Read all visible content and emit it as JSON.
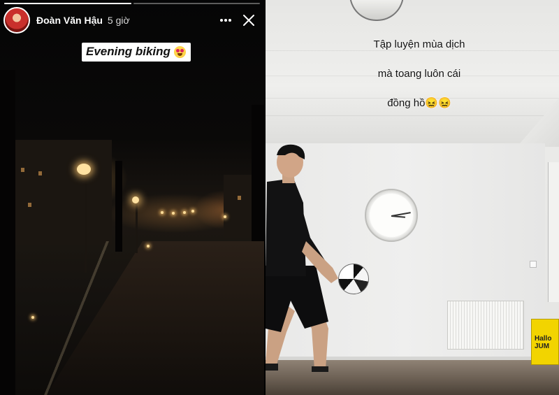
{
  "left_story": {
    "progress": [
      1.0,
      0.0
    ],
    "user": {
      "name": "Đoàn Văn Hậu",
      "time": "5 giờ"
    },
    "more_icon": "more-horizontal-icon",
    "close_icon": "close-icon",
    "sticker": {
      "text": "Evening biking",
      "emoji": "heart-eyes-emoji"
    }
  },
  "right_story": {
    "caption_line1": "Tập luyện mùa dịch",
    "caption_line2": "mà toang luôn cái",
    "caption_line3": "đồng hồ😖😖",
    "box_text_line1": "Hallo",
    "box_text_line2": "JUM"
  },
  "colors": {
    "background": "#000000",
    "sticker_bg": "#ffffff",
    "header_text": "#ffffff"
  }
}
